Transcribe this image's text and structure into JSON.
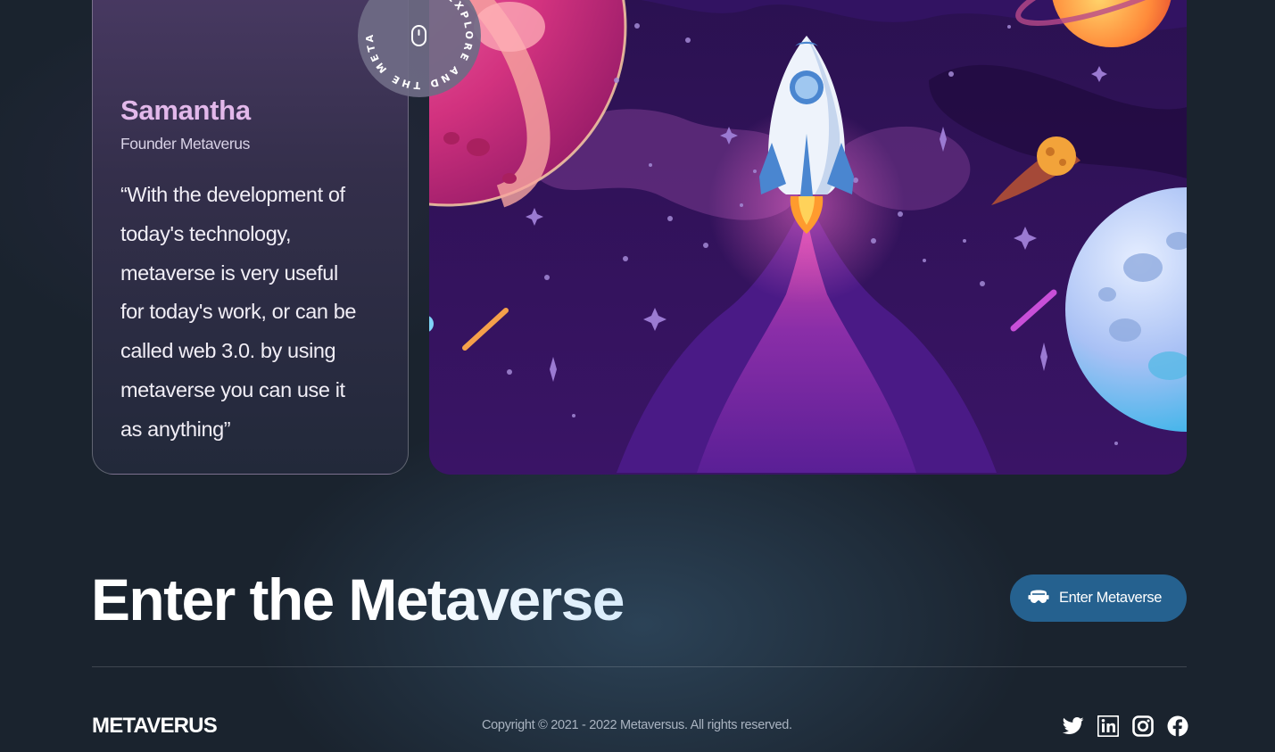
{
  "testimonial": {
    "name": "Samantha",
    "role": "Founder Metaverus",
    "quote_lines": [
      "“With the development of",
      "today's technology,",
      "metaverse is very useful",
      "for today's work, or can be",
      "called web 3.0. by using",
      "metaverse you can use it",
      "as anything”"
    ]
  },
  "badge": {
    "ring_text": "EXPLORE AND THE METAVERSE",
    "icon": "mouse-icon"
  },
  "illustration": {
    "subject": "rocket-launch-space-scene"
  },
  "cta": {
    "title": "Enter the Metaverse",
    "button_label": "Enter Metaverse",
    "button_icon": "vr-headset-icon",
    "button_color": "#25618f"
  },
  "footer": {
    "logo": "METAVERUS",
    "copyright": "Copyright © 2021 - 2022 Metaversus. All rights reserved.",
    "socials": [
      {
        "name": "twitter",
        "icon": "twitter-icon"
      },
      {
        "name": "linkedin",
        "icon": "linkedin-icon"
      },
      {
        "name": "instagram",
        "icon": "instagram-icon"
      },
      {
        "name": "facebook",
        "icon": "facebook-icon"
      }
    ]
  },
  "colors": {
    "background": "#1a232e",
    "name_accent": "#e2b8ea"
  }
}
